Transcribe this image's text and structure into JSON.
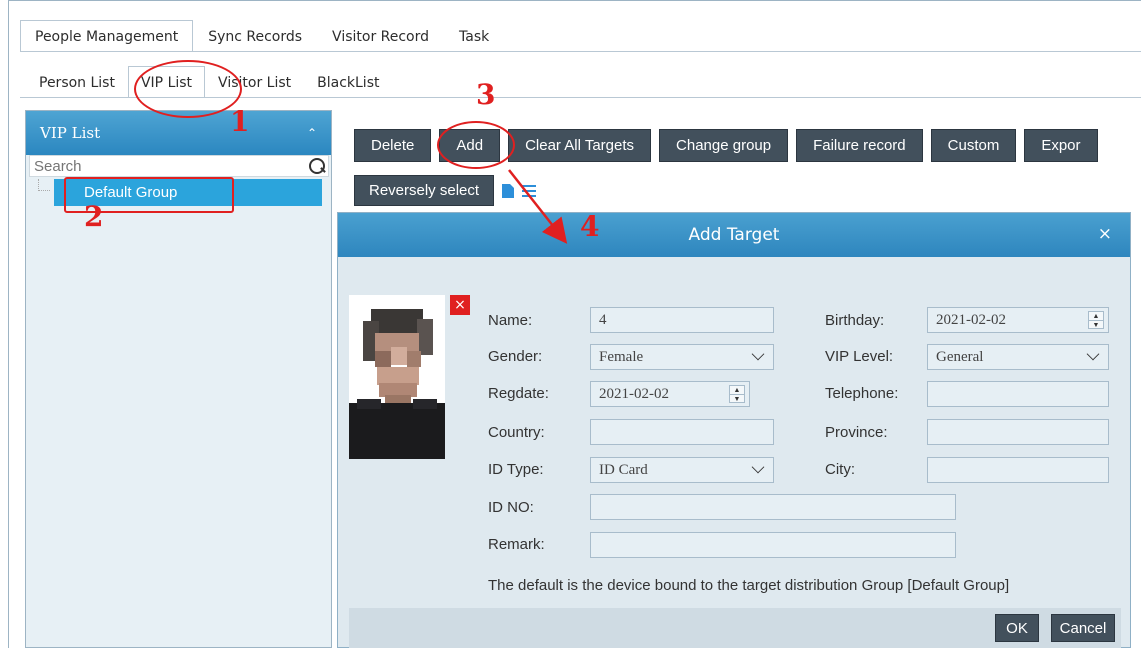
{
  "top_tabs": [
    "People Management",
    "Sync Records",
    "Visitor Record",
    "Task"
  ],
  "sub_tabs": [
    "Person List",
    "VIP List",
    "Visitor List",
    "BlackList"
  ],
  "left_panel": {
    "title": "VIP List",
    "search_placeholder": "Search",
    "group": "Default Group"
  },
  "toolbar": {
    "row1": [
      "Delete",
      "Add",
      "Clear All Targets",
      "Change group",
      "Failure record",
      "Custom",
      "Expor"
    ],
    "row2": "Reversely select"
  },
  "dialog": {
    "title": "Add Target",
    "close": "×",
    "labels": {
      "name": "Name:",
      "gender": "Gender:",
      "regdate": "Regdate:",
      "country": "Country:",
      "id_type": "ID Type:",
      "id_no": "ID NO:",
      "remark": "Remark:",
      "birthday": "Birthday:",
      "vip_level": "VIP Level:",
      "telephone": "Telephone:",
      "province": "Province:",
      "city": "City:"
    },
    "values": {
      "name": "4",
      "gender": "Female",
      "regdate": "2021-02-02",
      "country": "",
      "id_type": "ID Card",
      "id_no": "",
      "remark": "",
      "birthday": "2021-02-02",
      "vip_level": "General",
      "telephone": "",
      "province": "",
      "city": ""
    },
    "note": "The default is the device bound to the target distribution Group [Default Group]",
    "ok": "OK",
    "cancel": "Cancel"
  },
  "annotations": [
    "1",
    "2",
    "3",
    "4"
  ],
  "colors": {
    "accent": "#2ba4dc",
    "annotation": "#e02020",
    "button": "#42505c"
  }
}
